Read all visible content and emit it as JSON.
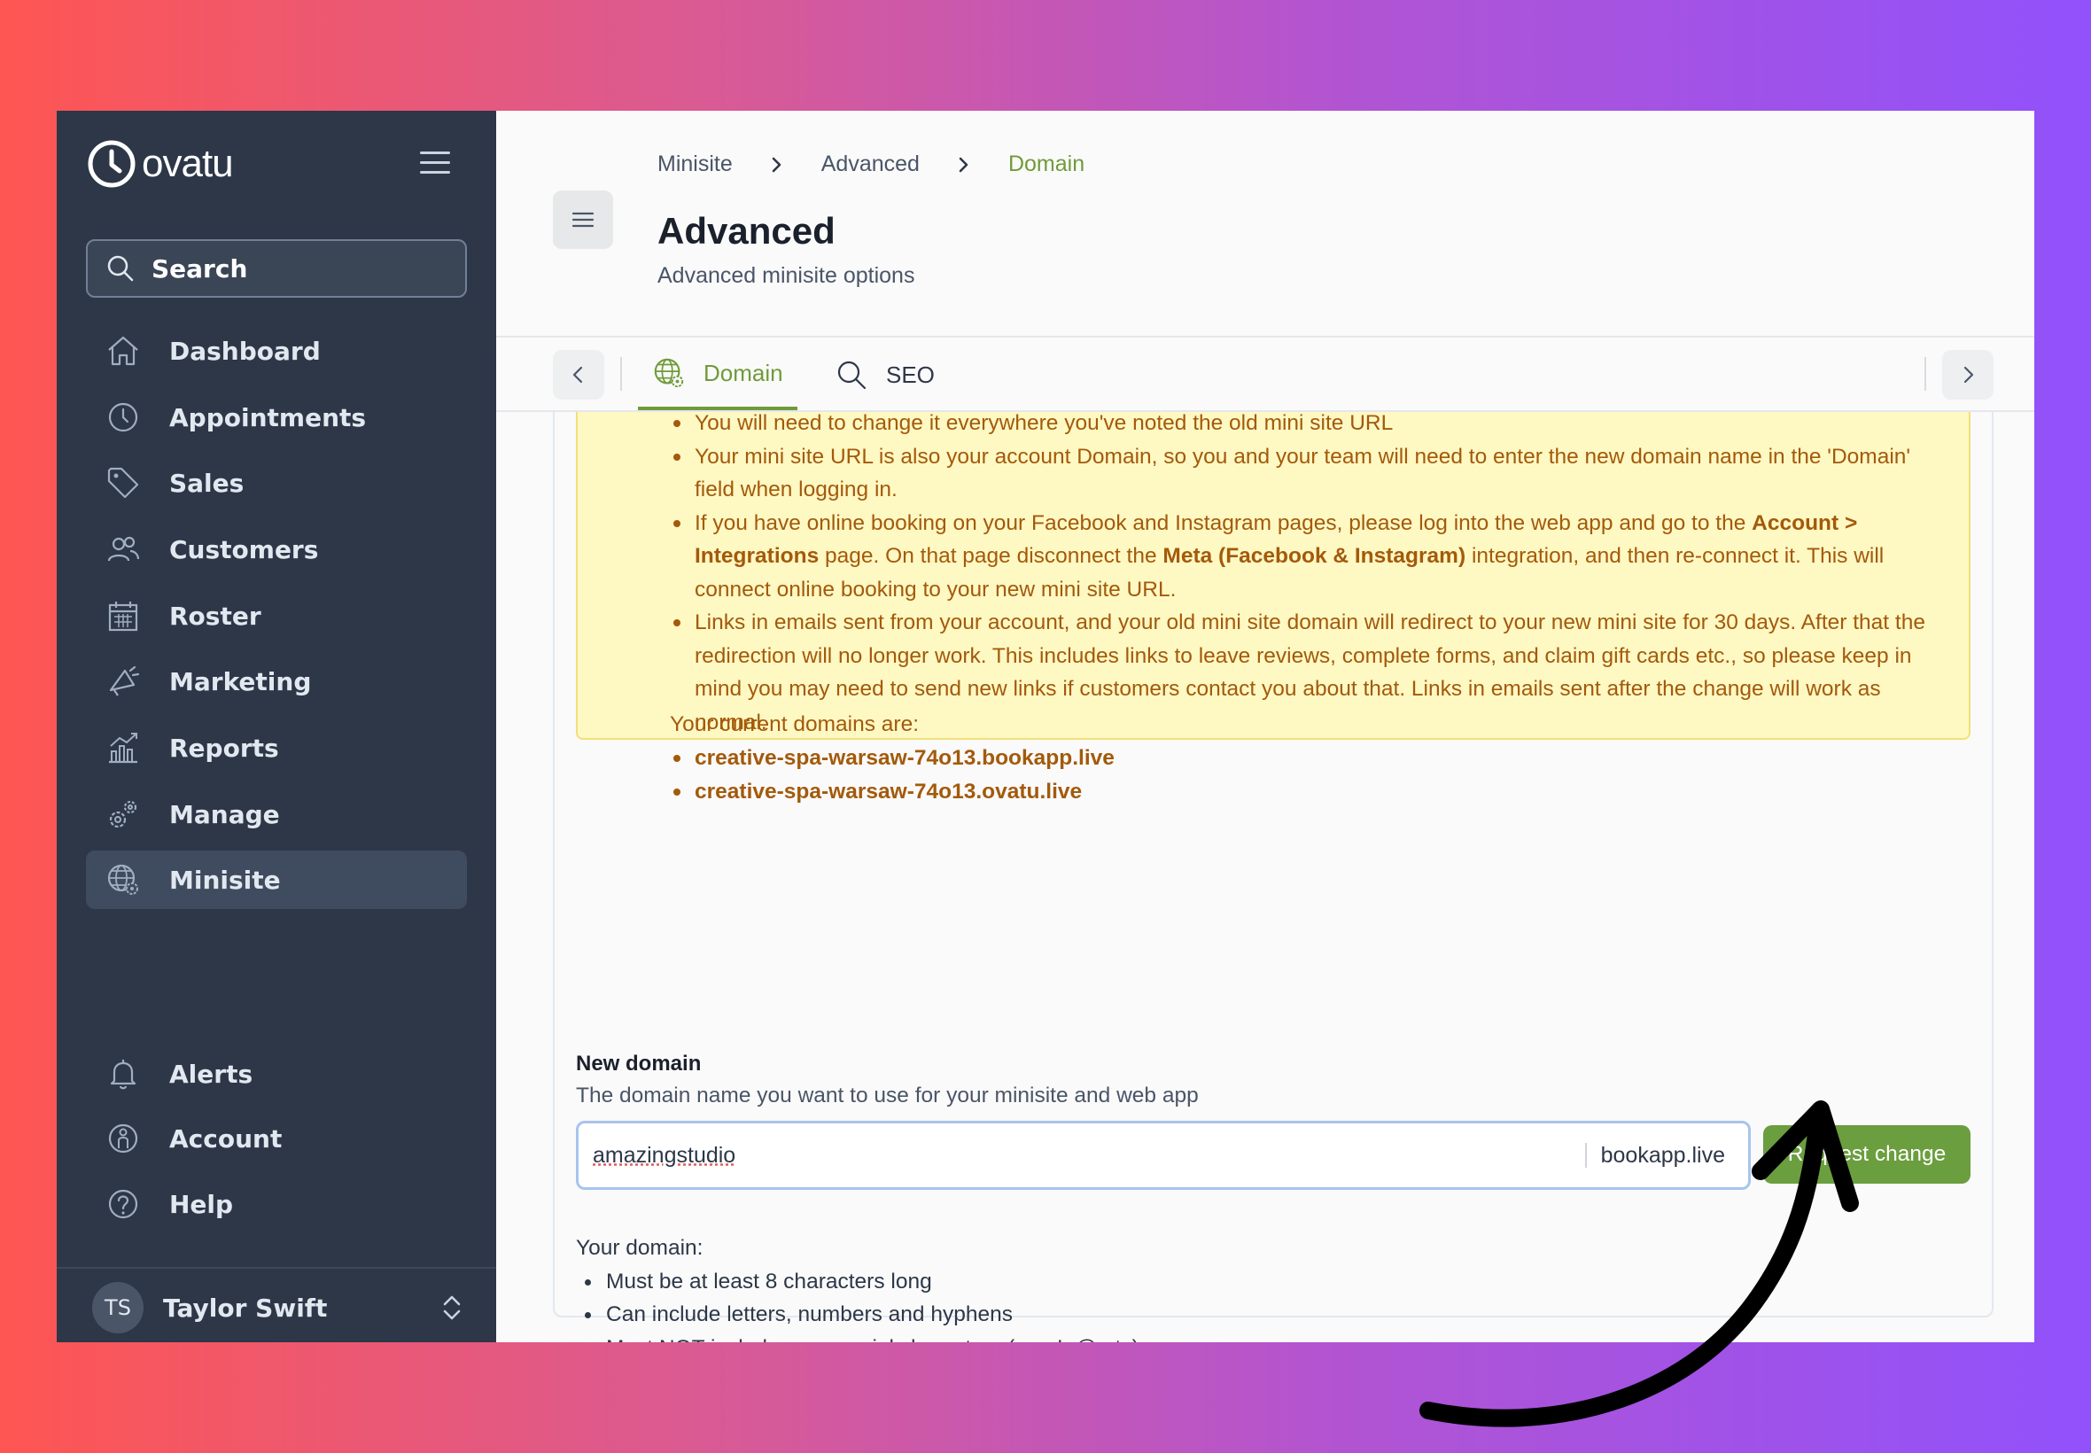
{
  "app": {
    "brand": "ovatu"
  },
  "sidebar": {
    "search_label": "Search",
    "items": [
      {
        "label": "Dashboard",
        "icon": "home-icon"
      },
      {
        "label": "Appointments",
        "icon": "clock-icon"
      },
      {
        "label": "Sales",
        "icon": "tag-icon"
      },
      {
        "label": "Customers",
        "icon": "users-icon"
      },
      {
        "label": "Roster",
        "icon": "calendar-icon"
      },
      {
        "label": "Marketing",
        "icon": "megaphone-icon"
      },
      {
        "label": "Reports",
        "icon": "chart-icon"
      },
      {
        "label": "Manage",
        "icon": "gears-icon"
      },
      {
        "label": "Minisite",
        "icon": "globe-gear-icon",
        "active": true
      }
    ],
    "bottom_items": [
      {
        "label": "Alerts",
        "icon": "bell-icon"
      },
      {
        "label": "Account",
        "icon": "account-icon"
      },
      {
        "label": "Help",
        "icon": "help-icon"
      }
    ],
    "user": {
      "initials": "TS",
      "name": "Taylor Swift"
    }
  },
  "header": {
    "breadcrumb": [
      "Minisite",
      "Advanced",
      "Domain"
    ],
    "title": "Advanced",
    "subtitle": "Advanced minisite options"
  },
  "tabs": [
    {
      "label": "Domain",
      "active": true
    },
    {
      "label": "SEO",
      "active": false
    }
  ],
  "notice": {
    "bullets": [
      "You will need to change it everywhere you've noted the old mini site URL",
      "Your mini site URL is also your account Domain, so you and your team will need to enter the new domain name in the 'Domain' field when logging in.",
      {
        "part1": "If you have online booking on your Facebook and Instagram pages, please log into the web app and go to the ",
        "bold1": "Account > Integrations",
        "part2": " page. On that page disconnect the ",
        "bold2": "Meta (Facebook & Instagram)",
        "part3": " integration, and then re-connect it. This will connect online booking to your new mini site URL."
      },
      "Links in emails sent from your account, and your old mini site domain will redirect to your new mini site for 30 days. After that the redirection will no longer work. This includes links to leave reviews, complete forms, and claim gift cards etc., so please keep in mind you may need to send new links if customers contact you about that. Links in emails sent after the change will work as normal."
    ],
    "domains_heading": "Your current domains are:",
    "domains": [
      "creative-spa-warsaw-74o13.bookapp.live",
      "creative-spa-warsaw-74o13.ovatu.live"
    ]
  },
  "new_domain": {
    "label": "New domain",
    "help": "The domain name you want to use for your minisite and web app",
    "value": "amazingstudio",
    "suffix": "bookapp.live",
    "button": "Request change"
  },
  "rules": {
    "heading": "Your domain:",
    "items": [
      "Must be at least 8 characters long",
      "Can include letters, numbers and hyphens",
      "Must NOT include any special characters (e.g. !, @ etc)"
    ]
  },
  "colors": {
    "accent": "#6f9b3a",
    "sidebar_bg": "#2d3748",
    "notice_bg": "#fef8c3",
    "notice_text": "#a35a0b"
  }
}
